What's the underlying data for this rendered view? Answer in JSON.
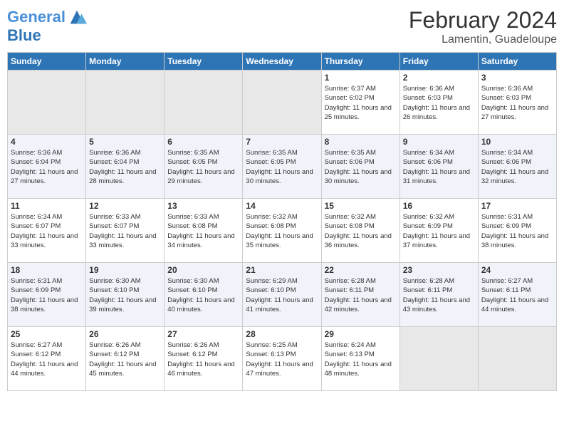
{
  "logo": {
    "line1": "General",
    "line2": "Blue"
  },
  "title": "February 2024",
  "subtitle": "Lamentin, Guadeloupe",
  "days_of_week": [
    "Sunday",
    "Monday",
    "Tuesday",
    "Wednesday",
    "Thursday",
    "Friday",
    "Saturday"
  ],
  "weeks": [
    [
      {
        "day": "",
        "info": ""
      },
      {
        "day": "",
        "info": ""
      },
      {
        "day": "",
        "info": ""
      },
      {
        "day": "",
        "info": ""
      },
      {
        "day": "1",
        "sunrise": "Sunrise: 6:37 AM",
        "sunset": "Sunset: 6:02 PM",
        "daylight": "Daylight: 11 hours and 25 minutes."
      },
      {
        "day": "2",
        "sunrise": "Sunrise: 6:36 AM",
        "sunset": "Sunset: 6:03 PM",
        "daylight": "Daylight: 11 hours and 26 minutes."
      },
      {
        "day": "3",
        "sunrise": "Sunrise: 6:36 AM",
        "sunset": "Sunset: 6:03 PM",
        "daylight": "Daylight: 11 hours and 27 minutes."
      }
    ],
    [
      {
        "day": "4",
        "sunrise": "Sunrise: 6:36 AM",
        "sunset": "Sunset: 6:04 PM",
        "daylight": "Daylight: 11 hours and 27 minutes."
      },
      {
        "day": "5",
        "sunrise": "Sunrise: 6:36 AM",
        "sunset": "Sunset: 6:04 PM",
        "daylight": "Daylight: 11 hours and 28 minutes."
      },
      {
        "day": "6",
        "sunrise": "Sunrise: 6:35 AM",
        "sunset": "Sunset: 6:05 PM",
        "daylight": "Daylight: 11 hours and 29 minutes."
      },
      {
        "day": "7",
        "sunrise": "Sunrise: 6:35 AM",
        "sunset": "Sunset: 6:05 PM",
        "daylight": "Daylight: 11 hours and 30 minutes."
      },
      {
        "day": "8",
        "sunrise": "Sunrise: 6:35 AM",
        "sunset": "Sunset: 6:06 PM",
        "daylight": "Daylight: 11 hours and 30 minutes."
      },
      {
        "day": "9",
        "sunrise": "Sunrise: 6:34 AM",
        "sunset": "Sunset: 6:06 PM",
        "daylight": "Daylight: 11 hours and 31 minutes."
      },
      {
        "day": "10",
        "sunrise": "Sunrise: 6:34 AM",
        "sunset": "Sunset: 6:06 PM",
        "daylight": "Daylight: 11 hours and 32 minutes."
      }
    ],
    [
      {
        "day": "11",
        "sunrise": "Sunrise: 6:34 AM",
        "sunset": "Sunset: 6:07 PM",
        "daylight": "Daylight: 11 hours and 33 minutes."
      },
      {
        "day": "12",
        "sunrise": "Sunrise: 6:33 AM",
        "sunset": "Sunset: 6:07 PM",
        "daylight": "Daylight: 11 hours and 33 minutes."
      },
      {
        "day": "13",
        "sunrise": "Sunrise: 6:33 AM",
        "sunset": "Sunset: 6:08 PM",
        "daylight": "Daylight: 11 hours and 34 minutes."
      },
      {
        "day": "14",
        "sunrise": "Sunrise: 6:32 AM",
        "sunset": "Sunset: 6:08 PM",
        "daylight": "Daylight: 11 hours and 35 minutes."
      },
      {
        "day": "15",
        "sunrise": "Sunrise: 6:32 AM",
        "sunset": "Sunset: 6:08 PM",
        "daylight": "Daylight: 11 hours and 36 minutes."
      },
      {
        "day": "16",
        "sunrise": "Sunrise: 6:32 AM",
        "sunset": "Sunset: 6:09 PM",
        "daylight": "Daylight: 11 hours and 37 minutes."
      },
      {
        "day": "17",
        "sunrise": "Sunrise: 6:31 AM",
        "sunset": "Sunset: 6:09 PM",
        "daylight": "Daylight: 11 hours and 38 minutes."
      }
    ],
    [
      {
        "day": "18",
        "sunrise": "Sunrise: 6:31 AM",
        "sunset": "Sunset: 6:09 PM",
        "daylight": "Daylight: 11 hours and 38 minutes."
      },
      {
        "day": "19",
        "sunrise": "Sunrise: 6:30 AM",
        "sunset": "Sunset: 6:10 PM",
        "daylight": "Daylight: 11 hours and 39 minutes."
      },
      {
        "day": "20",
        "sunrise": "Sunrise: 6:30 AM",
        "sunset": "Sunset: 6:10 PM",
        "daylight": "Daylight: 11 hours and 40 minutes."
      },
      {
        "day": "21",
        "sunrise": "Sunrise: 6:29 AM",
        "sunset": "Sunset: 6:10 PM",
        "daylight": "Daylight: 11 hours and 41 minutes."
      },
      {
        "day": "22",
        "sunrise": "Sunrise: 6:28 AM",
        "sunset": "Sunset: 6:11 PM",
        "daylight": "Daylight: 11 hours and 42 minutes."
      },
      {
        "day": "23",
        "sunrise": "Sunrise: 6:28 AM",
        "sunset": "Sunset: 6:11 PM",
        "daylight": "Daylight: 11 hours and 43 minutes."
      },
      {
        "day": "24",
        "sunrise": "Sunrise: 6:27 AM",
        "sunset": "Sunset: 6:11 PM",
        "daylight": "Daylight: 11 hours and 44 minutes."
      }
    ],
    [
      {
        "day": "25",
        "sunrise": "Sunrise: 6:27 AM",
        "sunset": "Sunset: 6:12 PM",
        "daylight": "Daylight: 11 hours and 44 minutes."
      },
      {
        "day": "26",
        "sunrise": "Sunrise: 6:26 AM",
        "sunset": "Sunset: 6:12 PM",
        "daylight": "Daylight: 11 hours and 45 minutes."
      },
      {
        "day": "27",
        "sunrise": "Sunrise: 6:26 AM",
        "sunset": "Sunset: 6:12 PM",
        "daylight": "Daylight: 11 hours and 46 minutes."
      },
      {
        "day": "28",
        "sunrise": "Sunrise: 6:25 AM",
        "sunset": "Sunset: 6:13 PM",
        "daylight": "Daylight: 11 hours and 47 minutes."
      },
      {
        "day": "29",
        "sunrise": "Sunrise: 6:24 AM",
        "sunset": "Sunset: 6:13 PM",
        "daylight": "Daylight: 11 hours and 48 minutes."
      },
      {
        "day": "",
        "info": ""
      },
      {
        "day": "",
        "info": ""
      }
    ]
  ]
}
